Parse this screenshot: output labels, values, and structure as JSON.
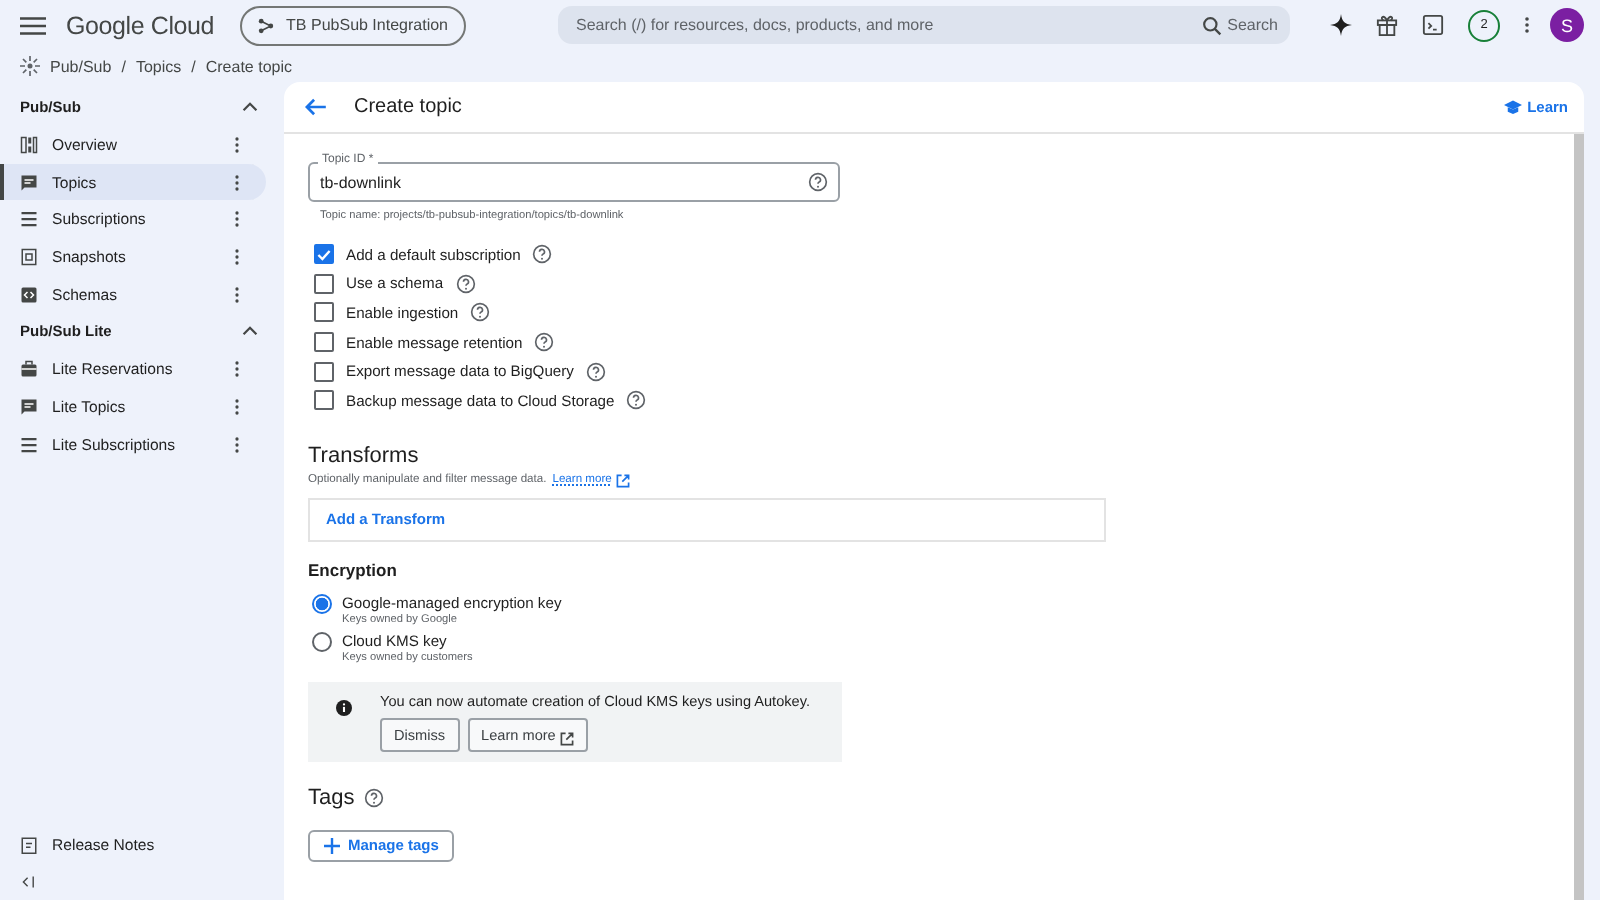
{
  "header": {
    "logo": "Google Cloud",
    "project": "TB PubSub Integration",
    "search": {
      "placeholder": "Search (/) for resources, docs, products, and more",
      "button": "Search"
    },
    "notifications": "2",
    "avatar": "S"
  },
  "breadcrumb": [
    {
      "label": "Pub/Sub",
      "separator": "/"
    },
    {
      "label": "Topics",
      "separator": "/"
    },
    {
      "label": "Create topic"
    }
  ],
  "sidebar": {
    "groups": [
      {
        "title": "Pub/Sub",
        "expanded": true,
        "items": [
          {
            "label": "Overview",
            "selected": false
          },
          {
            "label": "Topics",
            "selected": true
          },
          {
            "label": "Subscriptions",
            "selected": false
          },
          {
            "label": "Snapshots",
            "selected": false
          },
          {
            "label": "Schemas",
            "selected": false
          }
        ]
      },
      {
        "title": "Pub/Sub Lite",
        "expanded": true,
        "items": [
          {
            "label": "Lite Reservations",
            "selected": false
          },
          {
            "label": "Lite Topics",
            "selected": false
          },
          {
            "label": "Lite Subscriptions",
            "selected": false
          }
        ]
      }
    ],
    "footer": "Release Notes"
  },
  "page": {
    "title": "Create topic",
    "learn": "Learn"
  },
  "topic_id": {
    "label": "Topic ID *",
    "value": "tb-downlink",
    "hint": "Topic name: projects/tb-pubsub-integration/topics/tb-downlink"
  },
  "options": [
    {
      "label": "Add a default subscription",
      "checked": true
    },
    {
      "label": "Use a schema",
      "checked": false
    },
    {
      "label": "Enable ingestion",
      "checked": false
    },
    {
      "label": "Enable message retention",
      "checked": false
    },
    {
      "label": "Export message data to BigQuery",
      "checked": false
    },
    {
      "label": "Backup message data to Cloud Storage",
      "checked": false
    }
  ],
  "transforms": {
    "title": "Transforms",
    "description": "Optionally manipulate and filter message data.",
    "link": "Learn more",
    "add": "Add a Transform"
  },
  "encryption": {
    "title": "Encryption",
    "choices": [
      {
        "label": "Google-managed encryption key",
        "sublabel": "Keys owned by Google",
        "selected": true
      },
      {
        "label": "Cloud KMS key",
        "sublabel": "Keys owned by customers",
        "selected": false
      }
    ],
    "notice": {
      "text": "You can now automate creation of Cloud KMS keys using Autokey.",
      "buttons": [
        "Dismiss",
        "Learn more"
      ]
    }
  },
  "tags": {
    "title": "Tags",
    "button": "Manage tags"
  }
}
